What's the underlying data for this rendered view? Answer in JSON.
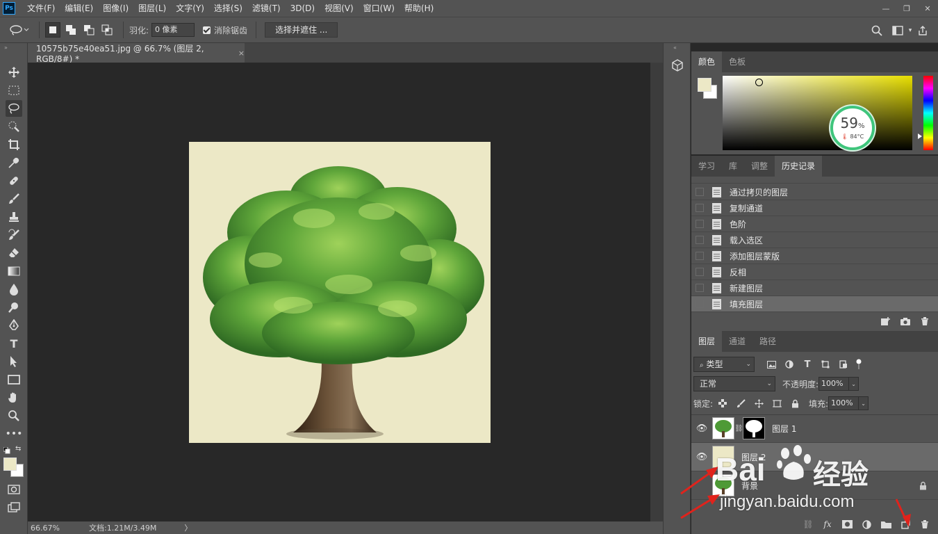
{
  "app": {
    "logo": "Ps"
  },
  "menu": [
    "文件(F)",
    "编辑(E)",
    "图像(I)",
    "图层(L)",
    "文字(Y)",
    "选择(S)",
    "滤镜(T)",
    "3D(D)",
    "视图(V)",
    "窗口(W)",
    "帮助(H)"
  ],
  "window_controls": {
    "minimize": "—",
    "restore": "❐",
    "close": "✕"
  },
  "options": {
    "feather_label": "羽化:",
    "feather_value": "0 像素",
    "antialias_label": "消除锯齿",
    "antialias_checked": true,
    "select_mask_label": "选择并遮住 ..."
  },
  "document": {
    "tab_title": "10575b75e40ea51.jpg @ 66.7% (图层 2, RGB/8#) *",
    "close": "×",
    "canvas_bg": "#ece8c6"
  },
  "status": {
    "zoom": "66.67%",
    "doc_info": "文档:1.21M/3.49M",
    "arrow": "〉"
  },
  "color_panel": {
    "tabs": [
      "颜色",
      "色板"
    ],
    "active_tab": 0,
    "foreground": "#ece8c6",
    "background": "#ffffff",
    "gauge_percent": "59",
    "gauge_percent_sign": "%",
    "gauge_temp": "84°C"
  },
  "history_panel": {
    "tabs": [
      "学习",
      "库",
      "调整",
      "历史记录"
    ],
    "active_tab": 3,
    "items": [
      "通过拷贝的图层",
      "复制通道",
      "色阶",
      "载入选区",
      "添加图层蒙版",
      "反相",
      "新建图层",
      "填充图层"
    ],
    "selected_index": 7
  },
  "layers_panel": {
    "tabs": [
      "图层",
      "通道",
      "路径"
    ],
    "active_tab": 0,
    "filter_label": "类型",
    "blend_mode": "正常",
    "opacity_label": "不透明度:",
    "opacity_value": "100%",
    "lock_label": "锁定:",
    "fill_label": "填充:",
    "fill_value": "100%",
    "layers": [
      {
        "name": "图层 1",
        "visible": true,
        "has_mask": true,
        "selected": false
      },
      {
        "name": "图层 2",
        "visible": true,
        "has_mask": false,
        "selected": true
      },
      {
        "name": "背景",
        "visible": false,
        "has_mask": false,
        "selected": false,
        "locked": true
      }
    ],
    "footer_icons": [
      "link-icon",
      "fx-icon",
      "mask-icon",
      "adjustment-icon",
      "group-icon",
      "new-layer-icon",
      "trash-icon"
    ]
  },
  "watermark": {
    "brand_left": "Bai",
    "brand_right": "经验",
    "url": "jingyan.baidu.com"
  },
  "annotation_color": "#e0231c"
}
